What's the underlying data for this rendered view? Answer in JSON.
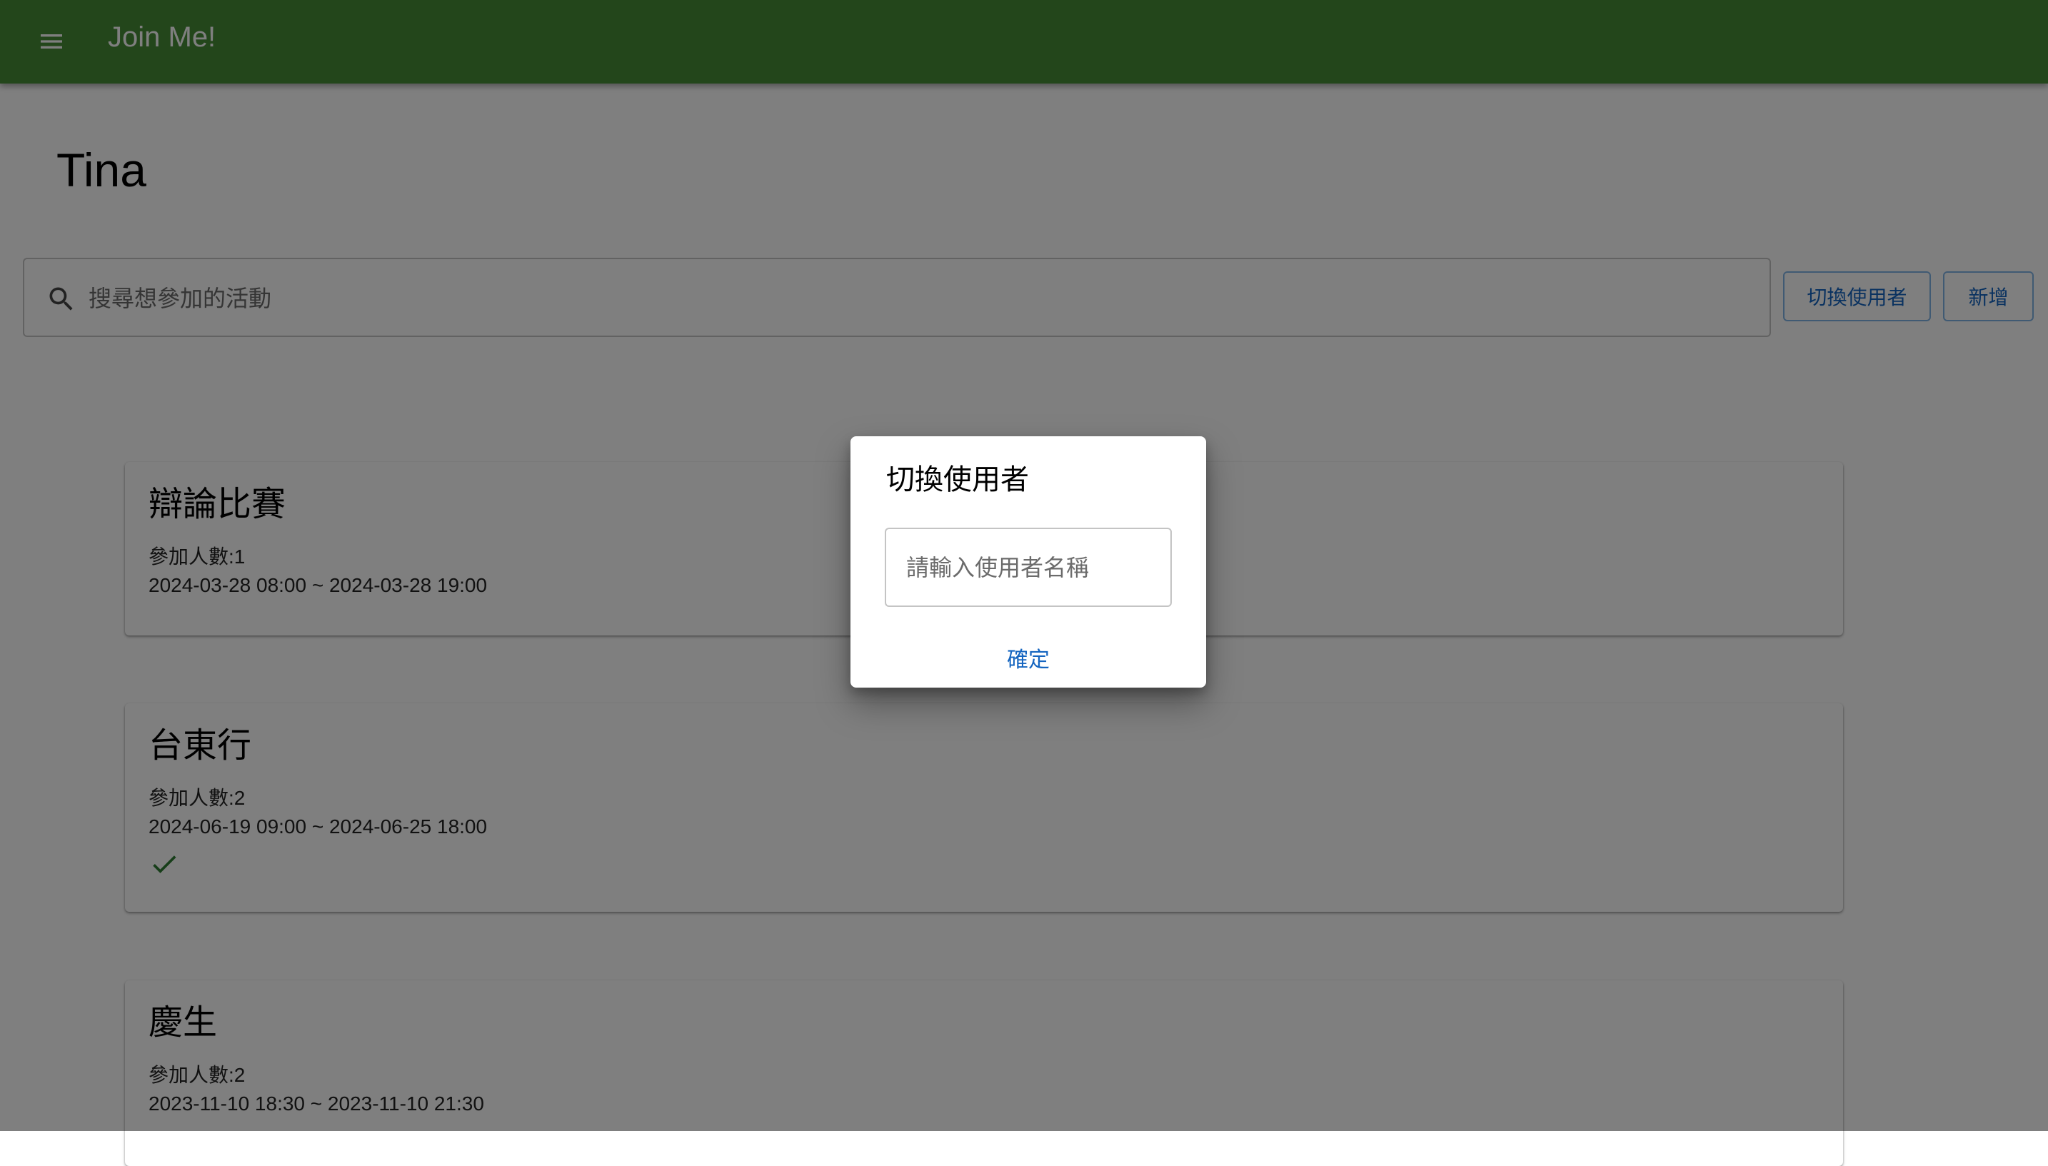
{
  "appbar": {
    "title": "Join Me!",
    "menu_icon": "menu-icon",
    "background_color": "#468c37"
  },
  "user": {
    "name": "Tina"
  },
  "search": {
    "placeholder": "搜尋想參加的活動",
    "value": "",
    "icon": "search-icon"
  },
  "actions": {
    "switch_user_label": "切換使用者",
    "add_label": "新增",
    "accent_color": "#1565c0"
  },
  "events": [
    {
      "title": "辯論比賽",
      "participants": "參加人數:1",
      "time_range": "2024-03-28 08:00 ~ 2024-03-28 19:00",
      "joined": false
    },
    {
      "title": "台東行",
      "participants": "參加人數:2",
      "time_range": "2024-06-19 09:00 ~ 2024-06-25 18:00",
      "joined": true,
      "joined_icon": "check-icon"
    },
    {
      "title": "慶生",
      "participants": "參加人數:2",
      "time_range": "2023-11-10 18:30 ~ 2023-11-10 21:30",
      "joined": false
    }
  ],
  "dialog": {
    "title": "切換使用者",
    "input_placeholder": "請輸入使用者名稱",
    "input_value": "",
    "confirm_label": "確定"
  }
}
